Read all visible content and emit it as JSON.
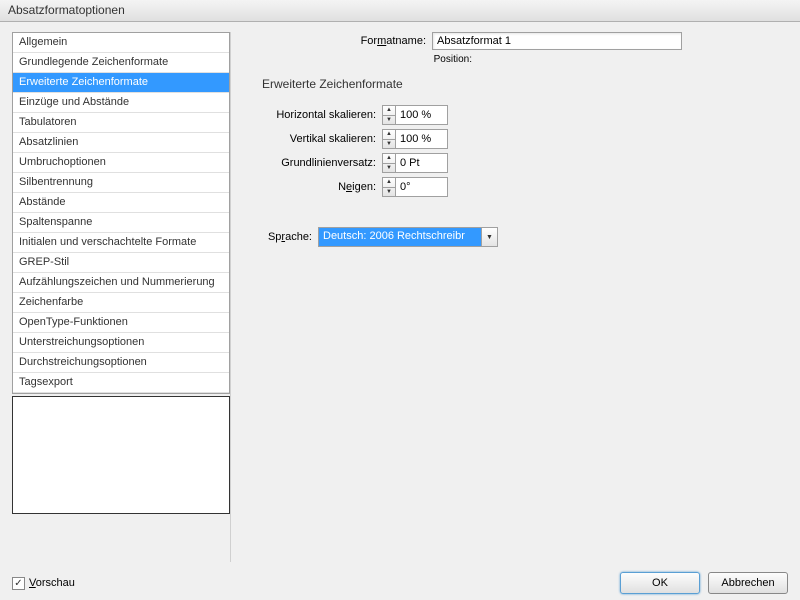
{
  "window": {
    "title": "Absatzformatoptionen"
  },
  "sidebar": {
    "selected_index": 2,
    "items": [
      "Allgemein",
      "Grundlegende Zeichenformate",
      "Erweiterte Zeichenformate",
      "Einzüge und Abstände",
      "Tabulatoren",
      "Absatzlinien",
      "Umbruchoptionen",
      "Silbentrennung",
      "Abstände",
      "Spaltenspanne",
      "Initialen und verschachtelte Formate",
      "GREP-Stil",
      "Aufzählungszeichen und Nummerierung",
      "Zeichenfarbe",
      "OpenType-Funktionen",
      "Unterstreichungsoptionen",
      "Durchstreichungsoptionen",
      "Tagsexport"
    ]
  },
  "header": {
    "formatname_label_pre": "For",
    "formatname_label_m": "m",
    "formatname_label_post": "atname:",
    "formatname_value": "Absatzformat 1",
    "position_label": "Position:"
  },
  "panel": {
    "title": "Erweiterte Zeichenformate",
    "fields": {
      "hscale": {
        "label": "Horizontal skalieren:",
        "value": "100 %"
      },
      "vscale": {
        "label": "Vertikal skalieren:",
        "value": "100 %"
      },
      "baseline": {
        "label": "Grundlinienversatz:",
        "value": "0 Pt"
      },
      "skew": {
        "label_pre": "N",
        "label_u": "e",
        "label_post": "igen:",
        "value": "0°"
      }
    },
    "language": {
      "label_pre": "Sp",
      "label_u": "r",
      "label_post": "ache:",
      "value": "Deutsch: 2006 Rechtschreibr"
    }
  },
  "footer": {
    "preview_label_pre": "",
    "preview_label_u": "V",
    "preview_label_post": "orschau",
    "preview_checked": true,
    "ok": "OK",
    "cancel": "Abbrechen"
  }
}
